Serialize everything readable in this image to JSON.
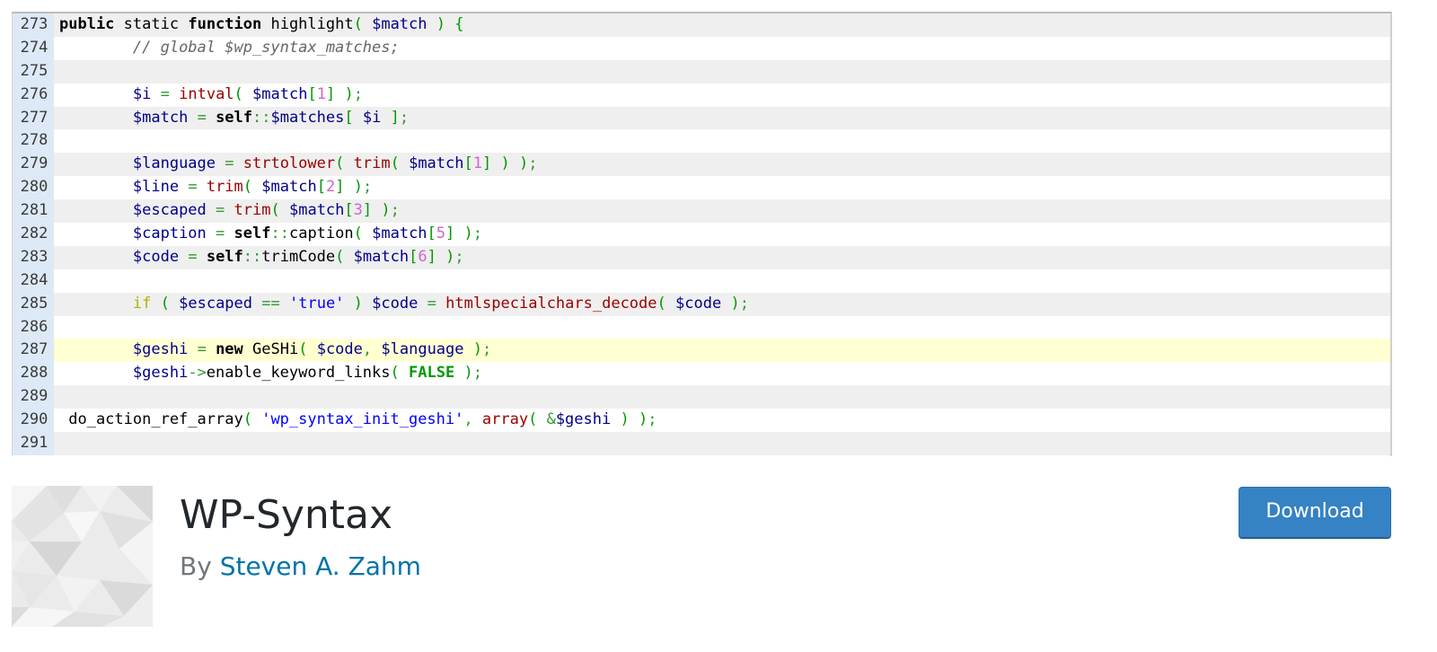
{
  "code_lines": [
    {
      "num": "273",
      "parts": [
        [
          "kw",
          "public"
        ],
        [
          "plain",
          " "
        ],
        [
          "kw2",
          "static"
        ],
        [
          "plain",
          " "
        ],
        [
          "kw",
          "function"
        ],
        [
          "plain",
          " highlight"
        ],
        [
          "paren",
          "("
        ],
        [
          "plain",
          " "
        ],
        [
          "var",
          "$match"
        ],
        [
          "plain",
          " "
        ],
        [
          "paren",
          ")"
        ],
        [
          "plain",
          " "
        ],
        [
          "paren",
          "{"
        ]
      ]
    },
    {
      "num": "274",
      "parts": [
        [
          "plain",
          "        "
        ],
        [
          "cmt",
          "// global $wp_syntax_matches;"
        ]
      ]
    },
    {
      "num": "275",
      "parts": []
    },
    {
      "num": "276",
      "parts": [
        [
          "plain",
          "        "
        ],
        [
          "var",
          "$i"
        ],
        [
          "plain",
          " "
        ],
        [
          "sym",
          "="
        ],
        [
          "plain",
          " "
        ],
        [
          "fn",
          "intval"
        ],
        [
          "paren",
          "("
        ],
        [
          "plain",
          " "
        ],
        [
          "var",
          "$match"
        ],
        [
          "paren",
          "["
        ],
        [
          "num",
          "1"
        ],
        [
          "paren",
          "]"
        ],
        [
          "plain",
          " "
        ],
        [
          "paren",
          ")"
        ],
        [
          "sym",
          ";"
        ]
      ]
    },
    {
      "num": "277",
      "parts": [
        [
          "plain",
          "        "
        ],
        [
          "var",
          "$match"
        ],
        [
          "plain",
          " "
        ],
        [
          "sym",
          "="
        ],
        [
          "plain",
          " "
        ],
        [
          "kw",
          "self"
        ],
        [
          "sym",
          "::"
        ],
        [
          "var",
          "$matches"
        ],
        [
          "paren",
          "["
        ],
        [
          "plain",
          " "
        ],
        [
          "var",
          "$i"
        ],
        [
          "plain",
          " "
        ],
        [
          "paren",
          "]"
        ],
        [
          "sym",
          ";"
        ]
      ]
    },
    {
      "num": "278",
      "parts": []
    },
    {
      "num": "279",
      "parts": [
        [
          "plain",
          "        "
        ],
        [
          "var",
          "$language"
        ],
        [
          "plain",
          " "
        ],
        [
          "sym",
          "="
        ],
        [
          "plain",
          " "
        ],
        [
          "fn",
          "strtolower"
        ],
        [
          "paren",
          "("
        ],
        [
          "plain",
          " "
        ],
        [
          "fn",
          "trim"
        ],
        [
          "paren",
          "("
        ],
        [
          "plain",
          " "
        ],
        [
          "var",
          "$match"
        ],
        [
          "paren",
          "["
        ],
        [
          "num",
          "1"
        ],
        [
          "paren",
          "]"
        ],
        [
          "plain",
          " "
        ],
        [
          "paren",
          ")"
        ],
        [
          "plain",
          " "
        ],
        [
          "paren",
          ")"
        ],
        [
          "sym",
          ";"
        ]
      ]
    },
    {
      "num": "280",
      "parts": [
        [
          "plain",
          "        "
        ],
        [
          "var",
          "$line"
        ],
        [
          "plain",
          " "
        ],
        [
          "sym",
          "="
        ],
        [
          "plain",
          " "
        ],
        [
          "fn",
          "trim"
        ],
        [
          "paren",
          "("
        ],
        [
          "plain",
          " "
        ],
        [
          "var",
          "$match"
        ],
        [
          "paren",
          "["
        ],
        [
          "num",
          "2"
        ],
        [
          "paren",
          "]"
        ],
        [
          "plain",
          " "
        ],
        [
          "paren",
          ")"
        ],
        [
          "sym",
          ";"
        ]
      ]
    },
    {
      "num": "281",
      "parts": [
        [
          "plain",
          "        "
        ],
        [
          "var",
          "$escaped"
        ],
        [
          "plain",
          " "
        ],
        [
          "sym",
          "="
        ],
        [
          "plain",
          " "
        ],
        [
          "fn",
          "trim"
        ],
        [
          "paren",
          "("
        ],
        [
          "plain",
          " "
        ],
        [
          "var",
          "$match"
        ],
        [
          "paren",
          "["
        ],
        [
          "num",
          "3"
        ],
        [
          "paren",
          "]"
        ],
        [
          "plain",
          " "
        ],
        [
          "paren",
          ")"
        ],
        [
          "sym",
          ";"
        ]
      ]
    },
    {
      "num": "282",
      "parts": [
        [
          "plain",
          "        "
        ],
        [
          "var",
          "$caption"
        ],
        [
          "plain",
          " "
        ],
        [
          "sym",
          "="
        ],
        [
          "plain",
          " "
        ],
        [
          "kw",
          "self"
        ],
        [
          "sym",
          "::"
        ],
        [
          "plain",
          "caption"
        ],
        [
          "paren",
          "("
        ],
        [
          "plain",
          " "
        ],
        [
          "var",
          "$match"
        ],
        [
          "paren",
          "["
        ],
        [
          "num",
          "5"
        ],
        [
          "paren",
          "]"
        ],
        [
          "plain",
          " "
        ],
        [
          "paren",
          ")"
        ],
        [
          "sym",
          ";"
        ]
      ]
    },
    {
      "num": "283",
      "parts": [
        [
          "plain",
          "        "
        ],
        [
          "var",
          "$code"
        ],
        [
          "plain",
          " "
        ],
        [
          "sym",
          "="
        ],
        [
          "plain",
          " "
        ],
        [
          "kw",
          "self"
        ],
        [
          "sym",
          "::"
        ],
        [
          "plain",
          "trimCode"
        ],
        [
          "paren",
          "("
        ],
        [
          "plain",
          " "
        ],
        [
          "var",
          "$match"
        ],
        [
          "paren",
          "["
        ],
        [
          "num",
          "6"
        ],
        [
          "paren",
          "]"
        ],
        [
          "plain",
          " "
        ],
        [
          "paren",
          ")"
        ],
        [
          "sym",
          ";"
        ]
      ]
    },
    {
      "num": "284",
      "parts": []
    },
    {
      "num": "285",
      "parts": [
        [
          "plain",
          "        "
        ],
        [
          "ctl",
          "if"
        ],
        [
          "plain",
          " "
        ],
        [
          "paren",
          "("
        ],
        [
          "plain",
          " "
        ],
        [
          "var",
          "$escaped"
        ],
        [
          "plain",
          " "
        ],
        [
          "sym",
          "=="
        ],
        [
          "plain",
          " "
        ],
        [
          "str",
          "'true'"
        ],
        [
          "plain",
          " "
        ],
        [
          "paren",
          ")"
        ],
        [
          "plain",
          " "
        ],
        [
          "var",
          "$code"
        ],
        [
          "plain",
          " "
        ],
        [
          "sym",
          "="
        ],
        [
          "plain",
          " "
        ],
        [
          "fn",
          "htmlspecialchars_decode"
        ],
        [
          "paren",
          "("
        ],
        [
          "plain",
          " "
        ],
        [
          "var",
          "$code"
        ],
        [
          "plain",
          " "
        ],
        [
          "paren",
          ")"
        ],
        [
          "sym",
          ";"
        ]
      ]
    },
    {
      "num": "286",
      "parts": []
    },
    {
      "num": "287",
      "highlight": true,
      "parts": [
        [
          "plain",
          "        "
        ],
        [
          "var",
          "$geshi"
        ],
        [
          "plain",
          " "
        ],
        [
          "sym",
          "="
        ],
        [
          "plain",
          " "
        ],
        [
          "kw",
          "new"
        ],
        [
          "plain",
          " GeSHi"
        ],
        [
          "paren",
          "("
        ],
        [
          "plain",
          " "
        ],
        [
          "var",
          "$code"
        ],
        [
          "sym",
          ","
        ],
        [
          "plain",
          " "
        ],
        [
          "var",
          "$language"
        ],
        [
          "plain",
          " "
        ],
        [
          "paren",
          ")"
        ],
        [
          "sym",
          ";"
        ]
      ]
    },
    {
      "num": "288",
      "parts": [
        [
          "plain",
          "        "
        ],
        [
          "var",
          "$geshi"
        ],
        [
          "sym",
          "->"
        ],
        [
          "plain",
          "enable_keyword_links"
        ],
        [
          "paren",
          "("
        ],
        [
          "plain",
          " "
        ],
        [
          "const",
          "FALSE"
        ],
        [
          "plain",
          " "
        ],
        [
          "paren",
          ")"
        ],
        [
          "sym",
          ";"
        ]
      ]
    },
    {
      "num": "289",
      "parts": []
    },
    {
      "num": "290",
      "parts": [
        [
          "plain",
          " do_action_ref_array"
        ],
        [
          "paren",
          "("
        ],
        [
          "plain",
          " "
        ],
        [
          "str",
          "'wp_syntax_init_geshi'"
        ],
        [
          "sym",
          ","
        ],
        [
          "plain",
          " "
        ],
        [
          "fn",
          "array"
        ],
        [
          "paren",
          "("
        ],
        [
          "plain",
          " "
        ],
        [
          "sym",
          "&"
        ],
        [
          "var",
          "$geshi"
        ],
        [
          "plain",
          " "
        ],
        [
          "paren",
          ")"
        ],
        [
          "plain",
          " "
        ],
        [
          "paren",
          ")"
        ],
        [
          "sym",
          ";"
        ]
      ]
    },
    {
      "num": "291",
      "parts": []
    }
  ],
  "plugin": {
    "title": "WP-Syntax",
    "by_label": "By",
    "author": "Steven A. Zahm",
    "download_label": "Download"
  },
  "colors": {
    "download_button": "#3582c4",
    "author_link": "#0073aa",
    "gutter": "#dde9f6",
    "highlight_line": "#ffffd2"
  }
}
